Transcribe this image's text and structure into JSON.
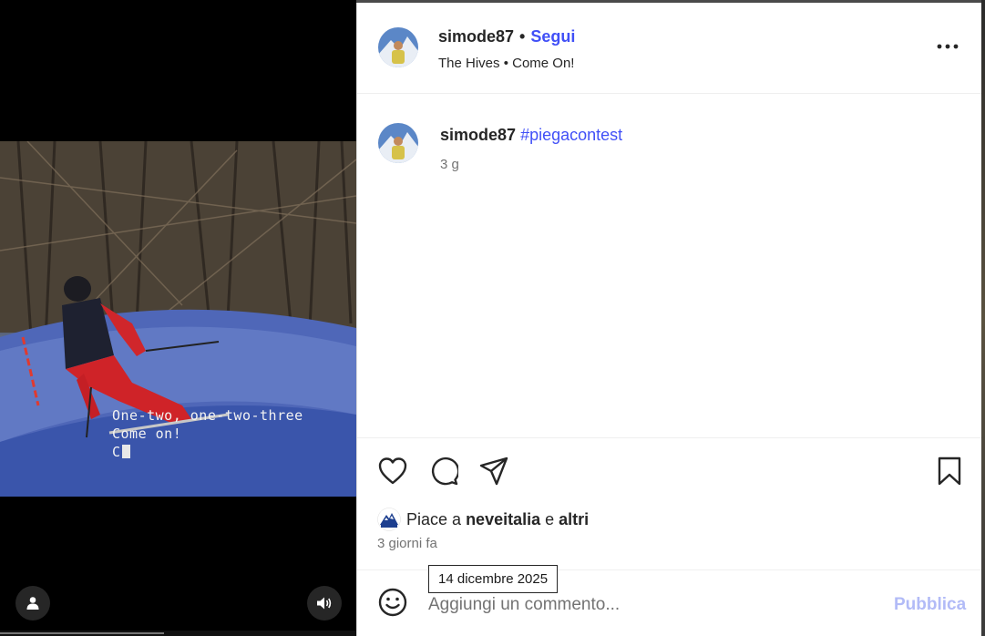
{
  "video": {
    "lyrics_line1": "One-two, one-two-three",
    "lyrics_line2": "Come on!",
    "lyrics_line3": "C",
    "user_button_icon": "user-icon",
    "sound_button_icon": "speaker-icon"
  },
  "post": {
    "header": {
      "username": "simode87",
      "separator": "•",
      "follow_label": "Segui",
      "audio": "The Hives • Come On!"
    },
    "caption": {
      "username": "simode87",
      "hashtag": "#piegacontest",
      "time": "3 g"
    },
    "actions": {
      "like_icon": "heart-icon",
      "comment_icon": "comment-icon",
      "share_icon": "send-icon",
      "save_icon": "bookmark-icon"
    },
    "likes": {
      "prefix": "Piace a",
      "user": "neveitalia",
      "conj": "e",
      "others": "altri"
    },
    "posted_ago": "3 giorni fa",
    "tooltip_date": "14 dicembre 2025",
    "comment": {
      "placeholder": "Aggiungi un commento...",
      "publish_label": "Pubblica"
    }
  },
  "colors": {
    "accent": "#4150f7",
    "publish_disabled": "#b2bbf7",
    "text": "#262626",
    "muted": "#737373"
  }
}
